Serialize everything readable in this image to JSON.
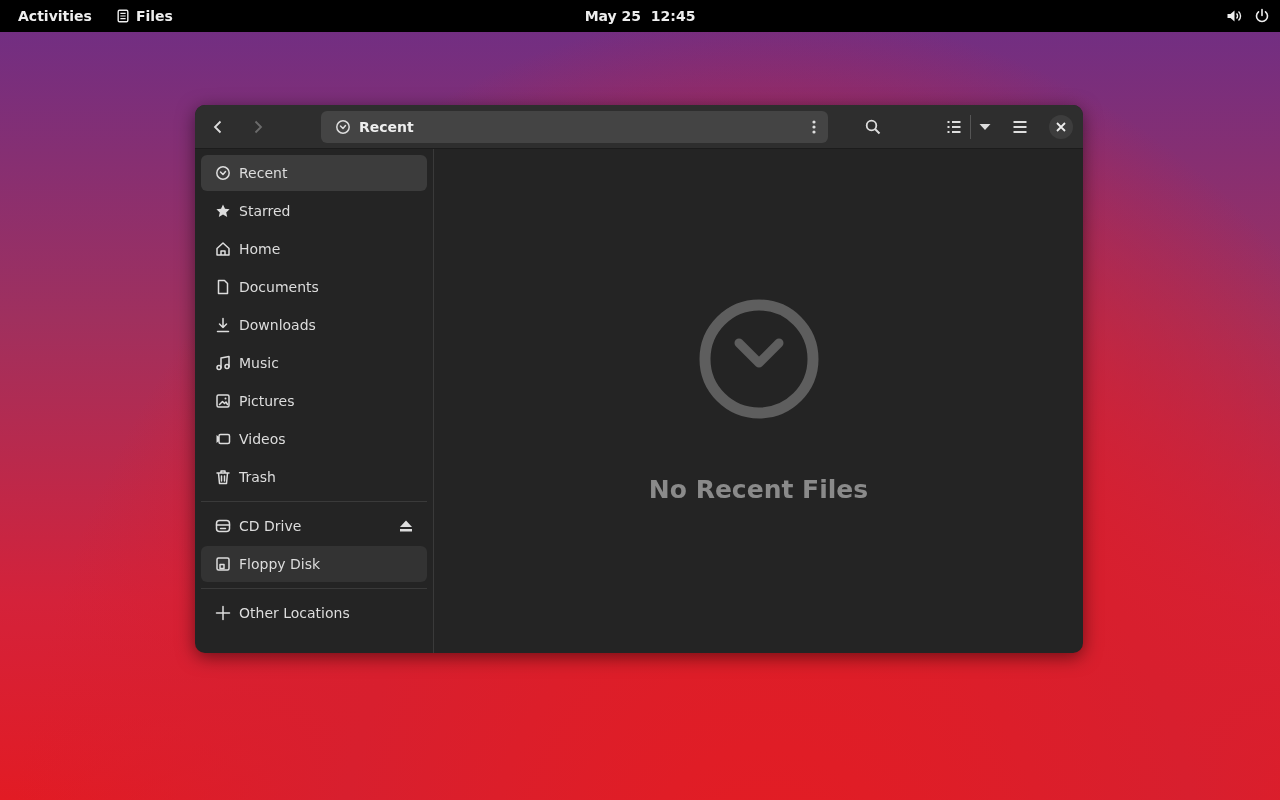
{
  "top_bar": {
    "activities": "Activities",
    "app_menu": "Files",
    "clock": "May 25  12:45"
  },
  "window": {
    "path": "Recent",
    "back_disabled": false,
    "forward_disabled": true
  },
  "sidebar": {
    "sections": [
      {
        "items": [
          {
            "label": "Recent",
            "selected": true,
            "hovered": false
          },
          {
            "label": "Starred",
            "selected": false,
            "hovered": false
          },
          {
            "label": "Home",
            "selected": false,
            "hovered": false
          },
          {
            "label": "Documents",
            "selected": false,
            "hovered": false
          },
          {
            "label": "Downloads",
            "selected": false,
            "hovered": false
          },
          {
            "label": "Music",
            "selected": false,
            "hovered": false
          },
          {
            "label": "Pictures",
            "selected": false,
            "hovered": false
          },
          {
            "label": "Videos",
            "selected": false,
            "hovered": false
          },
          {
            "label": "Trash",
            "selected": false,
            "hovered": false
          }
        ]
      },
      {
        "items": [
          {
            "label": "CD Drive",
            "selected": false,
            "hovered": false,
            "ejectable": true
          },
          {
            "label": "Floppy Disk",
            "selected": false,
            "hovered": true,
            "ejectable": false
          }
        ]
      },
      {
        "items": [
          {
            "label": "Other Locations",
            "selected": false,
            "hovered": false
          }
        ]
      }
    ]
  },
  "content": {
    "empty_message": "No Recent Files"
  }
}
